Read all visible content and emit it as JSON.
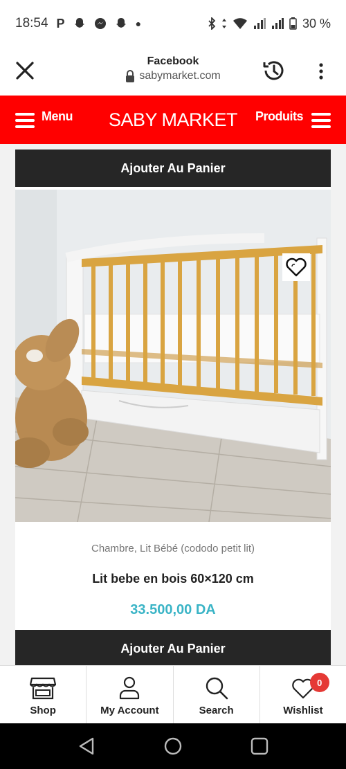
{
  "status_bar": {
    "time": "18:54",
    "battery": "30 %"
  },
  "browser": {
    "title": "Facebook",
    "url": "sabymarket.com"
  },
  "header": {
    "menu_label": "Menu",
    "brand": "SABY MARKET",
    "products_label": "Produits",
    "color": "#ff0000"
  },
  "product": {
    "add_to_cart_top": "Ajouter Au Panier",
    "category_1": "Chambre",
    "category_sep": ", ",
    "category_2": "Lit Bébé (cododo petit lit)",
    "name": "Lit bebe en bois 60×120 cm",
    "price": "33.500,00 DA",
    "price_color": "#3ab4c6",
    "add_to_cart_bottom": "Ajouter Au Panier"
  },
  "bottom_nav": {
    "items": [
      {
        "label": "Shop",
        "icon": "store-icon"
      },
      {
        "label": "My Account",
        "icon": "user-icon"
      },
      {
        "label": "Search",
        "icon": "search-icon"
      },
      {
        "label": "Wishlist",
        "icon": "heart-icon",
        "badge": "0"
      }
    ]
  }
}
